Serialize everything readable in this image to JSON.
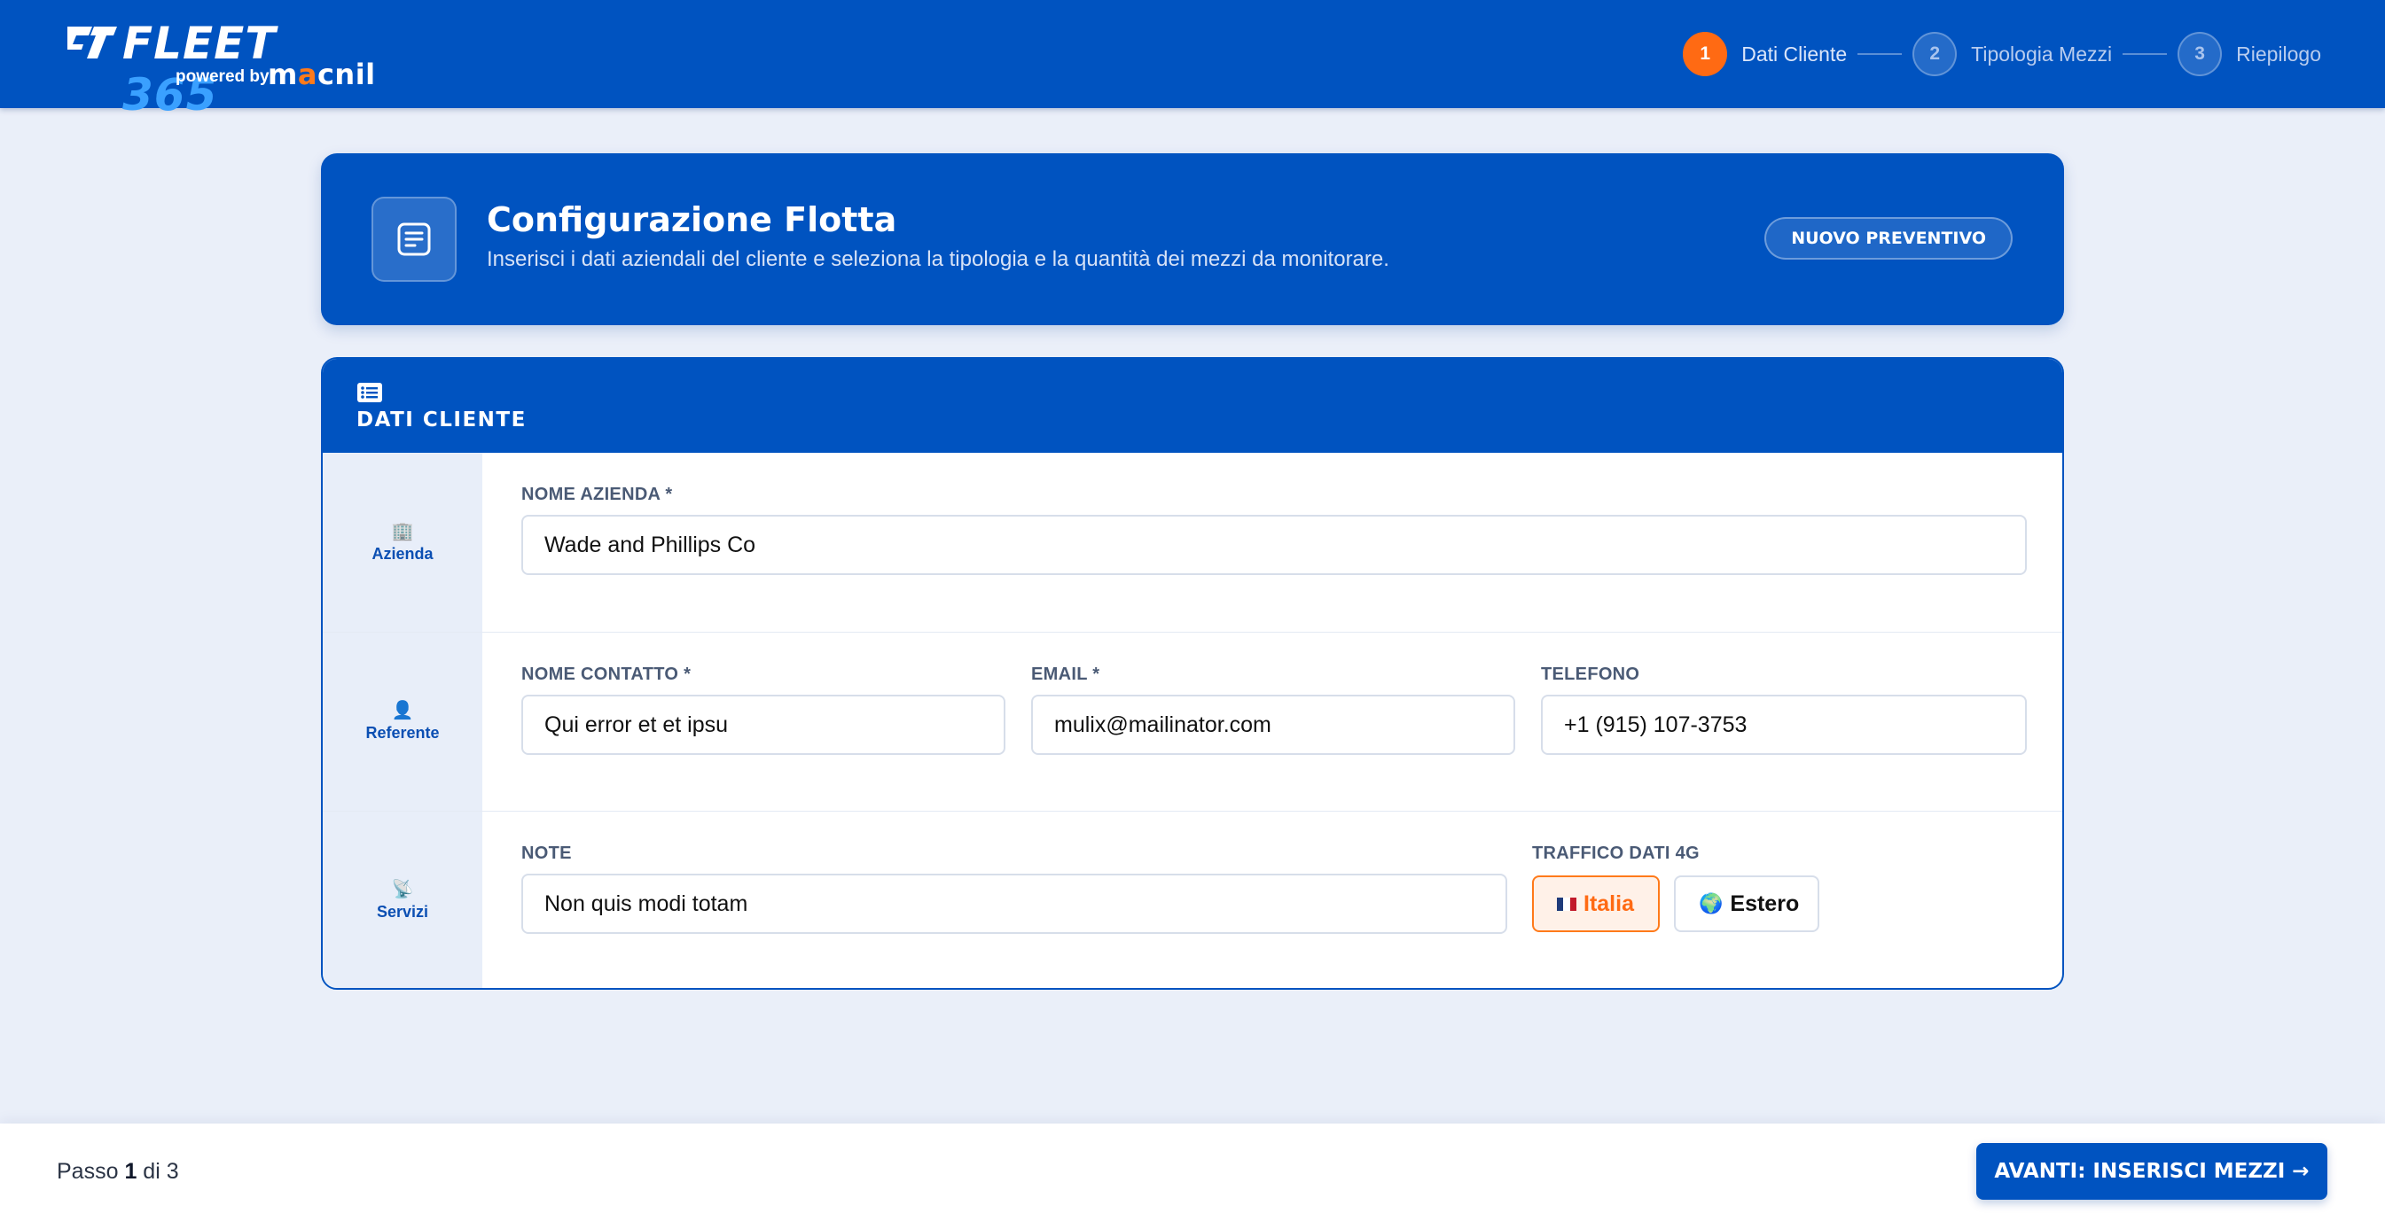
{
  "header": {
    "logo": {
      "brand": "FLEET",
      "number": "365",
      "powered_by": "powered by",
      "partner": "macnil"
    },
    "steps": [
      {
        "num": "1",
        "label": "Dati Cliente",
        "active": true
      },
      {
        "num": "2",
        "label": "Tipologia Mezzi",
        "active": false
      },
      {
        "num": "3",
        "label": "Riepilogo",
        "active": false
      }
    ]
  },
  "hero": {
    "title": "Configurazione Flotta",
    "subtitle": "Inserisci i dati aziendali del cliente e seleziona la tipologia e la quantità dei mezzi da monitorare.",
    "button": "NUOVO PREVENTIVO",
    "icon": "document-icon"
  },
  "client_card": {
    "title": "DATI CLIENTE",
    "icon": "list-icon",
    "sections": {
      "azienda": {
        "label": "Azienda",
        "icon": "🏢"
      },
      "referente": {
        "label": "Referente",
        "icon": "👤"
      },
      "servizi": {
        "label": "Servizi",
        "icon": "📡"
      }
    },
    "fields": {
      "company_name": {
        "label": "NOME AZIENDA *",
        "value": "Wade and Phillips Co"
      },
      "contact_name": {
        "label": "NOME CONTATTO *",
        "value": "Qui error et et ipsu"
      },
      "email": {
        "label": "EMAIL *",
        "value": "mulix@mailinator.com"
      },
      "phone": {
        "label": "TELEFONO",
        "value": "+1 (915) 107-3753"
      },
      "note": {
        "label": "NOTE",
        "value": "Non quis modi totam"
      },
      "traffic": {
        "label": "TRAFFICO DATI 4G",
        "options": [
          {
            "label": "Italia",
            "selected": true
          },
          {
            "label": "Estero",
            "selected": false
          }
        ]
      }
    }
  },
  "footer": {
    "step_prefix": "Passo",
    "step_current": "1",
    "step_suffix": "di 3",
    "next_button": "AVANTI: INSERISCI MEZZI →"
  },
  "colors": {
    "primary": "#0053c0",
    "accent": "#ff6a13",
    "background": "#eaeff9"
  }
}
